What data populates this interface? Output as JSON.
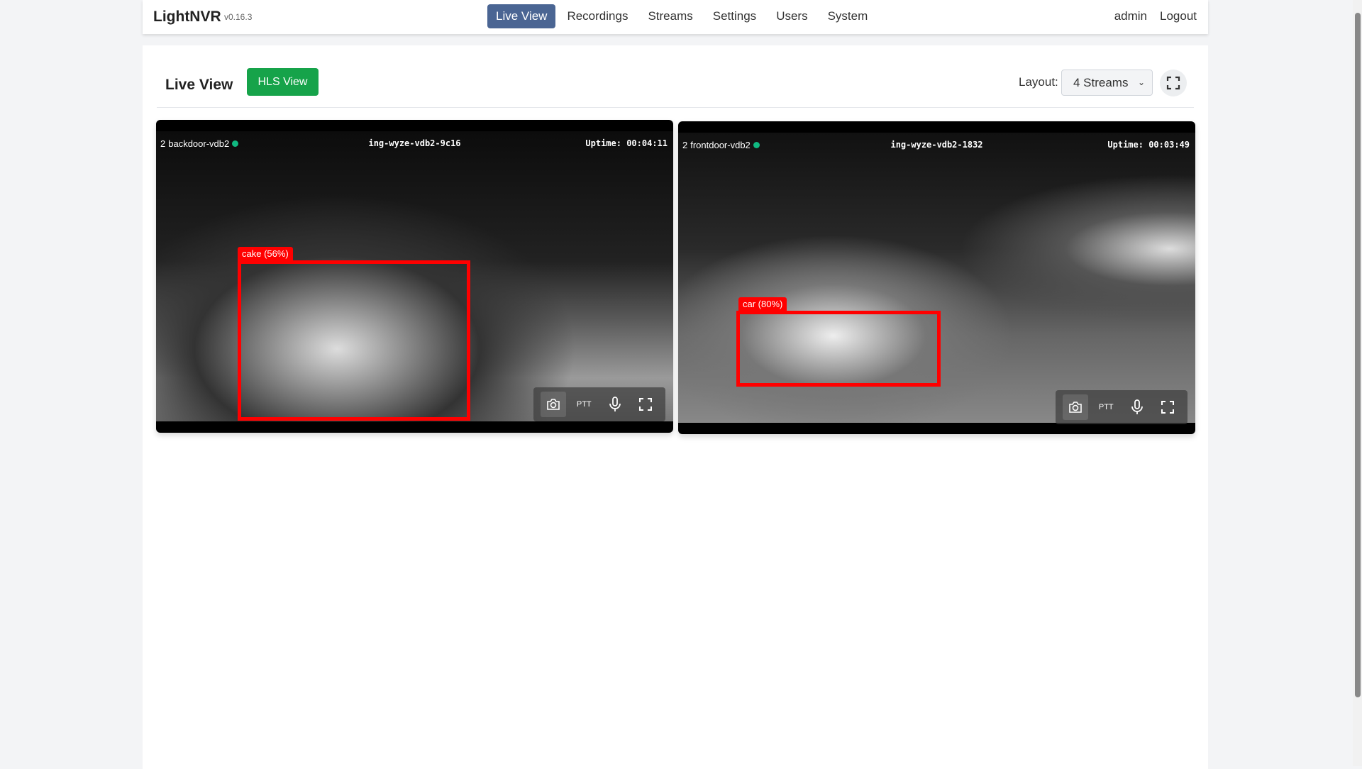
{
  "header": {
    "brand": "LightNVR",
    "version": "v0.16.3",
    "nav": [
      {
        "label": "Live View",
        "active": true
      },
      {
        "label": "Recordings"
      },
      {
        "label": "Streams"
      },
      {
        "label": "Settings"
      },
      {
        "label": "Users"
      },
      {
        "label": "System"
      }
    ],
    "user": "admin",
    "logout": "Logout"
  },
  "toolbar": {
    "title": "Live View",
    "hls_button": "HLS View",
    "layout_label": "Layout:",
    "layout_value": "4 Streams"
  },
  "streams": [
    {
      "name": "backdoor-vdb2",
      "prefix": "2",
      "camera_id": "ing-wyze-vdb2-9c16",
      "uptime": "Uptime: 00:04:11",
      "detection": "cake (56%)",
      "ptt": "PTT"
    },
    {
      "name": "frontdoor-vdb2",
      "prefix": "2",
      "camera_id": "ing-wyze-vdb2-1832",
      "uptime": "Uptime: 00:03:49",
      "detection": "car (80%)",
      "ptt": "PTT"
    }
  ],
  "colors": {
    "accent": "#4a6593",
    "hls": "#16a34a",
    "detection": "#ff0000",
    "status": "#10b981"
  }
}
